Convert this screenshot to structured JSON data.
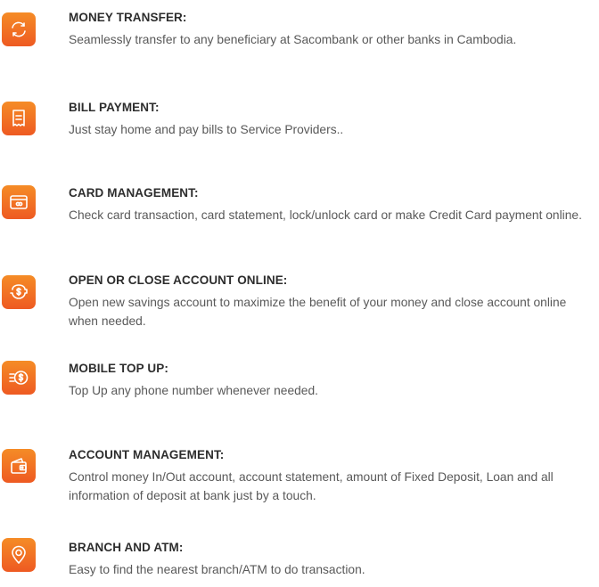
{
  "features": [
    {
      "icon": "transfer-icon",
      "title": "MONEY TRANSFER:",
      "description": "Seamlessly transfer to any beneficiary at Sacombank or other banks in Cambodia."
    },
    {
      "icon": "bill-icon",
      "title": "BILL PAYMENT:",
      "description": "Just stay home and pay bills to Service Providers.."
    },
    {
      "icon": "card-icon",
      "title": "CARD MANAGEMENT:",
      "description": "Check card transaction, card statement, lock/unlock card or make Credit Card payment online."
    },
    {
      "icon": "piggy-bank-icon",
      "title": "OPEN OR CLOSE ACCOUNT ONLINE:",
      "description": "Open new savings account to maximize the benefit of your money and close account online when needed."
    },
    {
      "icon": "topup-icon",
      "title": "MOBILE TOP UP:",
      "description": "Top Up any phone number whenever needed."
    },
    {
      "icon": "wallet-icon",
      "title": "ACCOUNT MANAGEMENT:",
      "description": "Control money In/Out account, account statement, amount of Fixed Deposit, Loan and all information of deposit at bank just by a touch."
    },
    {
      "icon": "location-pin-icon",
      "title": "BRANCH AND ATM:",
      "description": "Easy to find the nearest branch/ATM to do transaction."
    }
  ]
}
